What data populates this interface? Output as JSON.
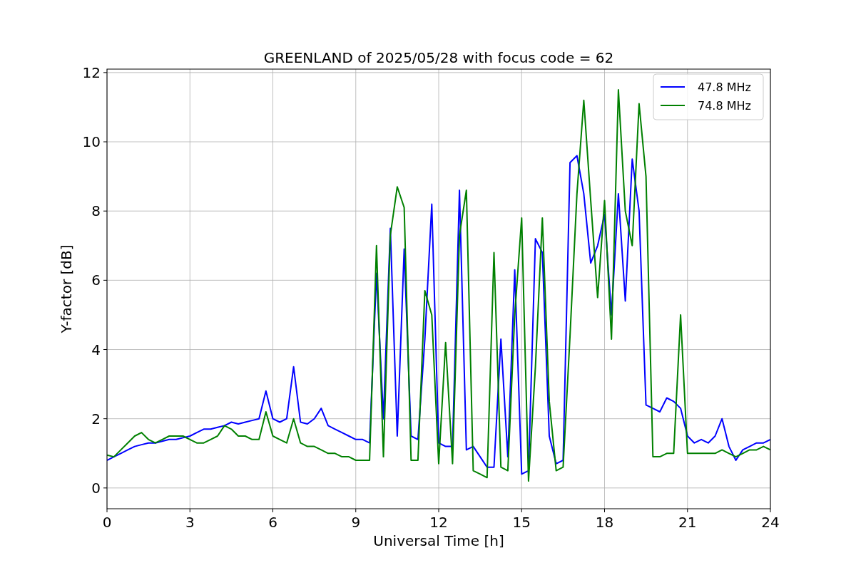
{
  "figure": {
    "chart_data": {
      "type": "line",
      "title": "GREENLAND of 2025/05/28 with focus code = 62",
      "xlabel": "Universal Time [h]",
      "ylabel": "Y-factor [dB]",
      "x": [
        0,
        0.25,
        0.5,
        0.75,
        1,
        1.25,
        1.5,
        1.75,
        2,
        2.25,
        2.5,
        2.75,
        3,
        3.25,
        3.5,
        3.75,
        4,
        4.25,
        4.5,
        4.75,
        5,
        5.25,
        5.5,
        5.75,
        6,
        6.25,
        6.5,
        6.75,
        7,
        7.25,
        7.5,
        7.75,
        8,
        8.25,
        8.5,
        8.75,
        9,
        9.25,
        9.5,
        9.75,
        10,
        10.25,
        10.5,
        10.75,
        11,
        11.25,
        11.5,
        11.75,
        12,
        12.25,
        12.5,
        12.75,
        13,
        13.25,
        13.5,
        13.75,
        14,
        14.25,
        14.5,
        14.75,
        15,
        15.25,
        15.5,
        15.75,
        16,
        16.25,
        16.5,
        16.75,
        17,
        17.25,
        17.5,
        17.75,
        18,
        18.25,
        18.5,
        18.75,
        19,
        19.25,
        19.5,
        19.75,
        20,
        20.25,
        20.5,
        20.75,
        21,
        21.25,
        21.5,
        21.75,
        22,
        22.25,
        22.5,
        22.75,
        23,
        23.25,
        23.5,
        23.75,
        24
      ],
      "series": [
        {
          "name": "47.8 MHz",
          "color": "#0000ff",
          "values": [
            0.8,
            0.9,
            1.0,
            1.1,
            1.2,
            1.25,
            1.3,
            1.3,
            1.35,
            1.4,
            1.4,
            1.45,
            1.5,
            1.6,
            1.7,
            1.7,
            1.75,
            1.8,
            1.9,
            1.85,
            1.9,
            1.95,
            2.0,
            2.8,
            2.0,
            1.9,
            2.0,
            3.5,
            1.9,
            1.85,
            2.0,
            2.3,
            1.8,
            1.7,
            1.6,
            1.5,
            1.4,
            1.4,
            1.3,
            6.2,
            2.0,
            7.5,
            1.5,
            6.9,
            1.5,
            1.4,
            4.3,
            8.2,
            1.3,
            1.2,
            1.2,
            8.6,
            1.1,
            1.2,
            0.9,
            0.6,
            0.6,
            4.3,
            0.9,
            6.3,
            0.4,
            0.5,
            7.2,
            6.8,
            1.5,
            0.7,
            0.8,
            9.4,
            9.6,
            8.5,
            6.5,
            7.0,
            7.9,
            5.0,
            8.5,
            5.4,
            9.5,
            8.0,
            2.4,
            2.3,
            2.2,
            2.6,
            2.5,
            2.3,
            1.5,
            1.3,
            1.4,
            1.3,
            1.5,
            2.0,
            1.2,
            0.8,
            1.1,
            1.2,
            1.3,
            1.3,
            1.4
          ]
        },
        {
          "name": "74.8 MHz",
          "color": "#008000",
          "values": [
            0.95,
            0.9,
            1.1,
            1.3,
            1.5,
            1.6,
            1.4,
            1.3,
            1.4,
            1.5,
            1.5,
            1.5,
            1.4,
            1.3,
            1.3,
            1.4,
            1.5,
            1.8,
            1.7,
            1.5,
            1.5,
            1.4,
            1.4,
            2.2,
            1.5,
            1.4,
            1.3,
            2.0,
            1.3,
            1.2,
            1.2,
            1.1,
            1.0,
            1.0,
            0.9,
            0.9,
            0.8,
            0.8,
            0.8,
            7.0,
            0.9,
            7.3,
            8.7,
            8.1,
            0.8,
            0.8,
            5.7,
            5.0,
            0.7,
            4.2,
            0.7,
            7.3,
            8.6,
            0.5,
            0.4,
            0.3,
            6.8,
            0.6,
            0.5,
            5.0,
            7.8,
            0.2,
            3.5,
            7.8,
            2.5,
            0.5,
            0.6,
            4.4,
            8.5,
            11.2,
            8.3,
            5.5,
            8.3,
            4.3,
            11.5,
            8.0,
            7.0,
            11.1,
            9.0,
            0.9,
            0.9,
            1.0,
            1.0,
            5.0,
            1.0,
            1.0,
            1.0,
            1.0,
            1.0,
            1.1,
            1.0,
            0.9,
            1.0,
            1.1,
            1.1,
            1.2,
            1.1
          ]
        }
      ],
      "xlim": [
        0,
        24
      ],
      "ylim": [
        -0.6,
        12.1
      ],
      "xticks": [
        0,
        3,
        6,
        9,
        12,
        15,
        18,
        21,
        24
      ],
      "yticks": [
        0,
        2,
        4,
        6,
        8,
        10,
        12
      ],
      "grid": true,
      "legend": true
    }
  }
}
